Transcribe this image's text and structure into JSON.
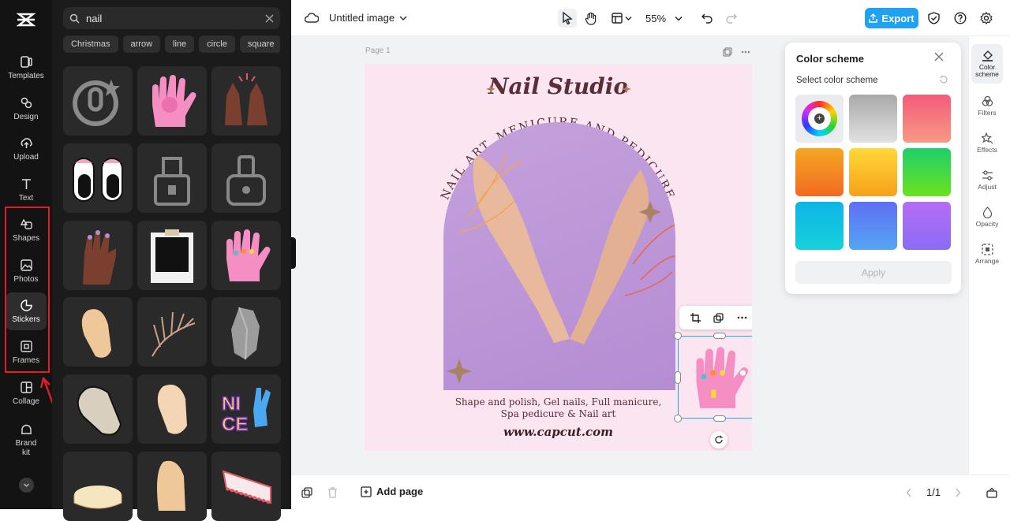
{
  "sidebar": {
    "items": [
      {
        "label": "Templates",
        "icon": "templates-icon"
      },
      {
        "label": "Design",
        "icon": "design-icon"
      },
      {
        "label": "Upload",
        "icon": "upload-icon"
      },
      {
        "label": "Text",
        "icon": "text-icon"
      },
      {
        "label": "Shapes",
        "icon": "shapes-icon"
      },
      {
        "label": "Photos",
        "icon": "photos-icon"
      },
      {
        "label": "Stickers",
        "icon": "stickers-icon"
      },
      {
        "label": "Frames",
        "icon": "frames-icon"
      },
      {
        "label": "Collage",
        "icon": "collage-icon"
      },
      {
        "label": "Brand kit",
        "icon": "brand-kit-icon"
      }
    ],
    "active": "Stickers"
  },
  "search": {
    "value": "nail"
  },
  "chips": [
    "Christmas",
    "arrow",
    "line",
    "circle",
    "square"
  ],
  "topbar": {
    "doc_title": "Untitled image",
    "zoom": "55%",
    "export_label": "Export"
  },
  "workspace": {
    "page_label": "Page 1"
  },
  "canvas": {
    "title": "Nail Studio",
    "arc_text": "NAIL ART, MENICURE AND PEDICURE",
    "desc_line1": "Shape and polish, Gel nails, Full manicure,",
    "desc_line2": "Spa pedicure & Nail art",
    "url": "www.capcut.com"
  },
  "color_scheme": {
    "title": "Color scheme",
    "subtitle": "Select color scheme",
    "apply_label": "Apply",
    "swatches": [
      "picker",
      "#c9c9c9",
      "#f06b80",
      "#f7941d",
      "#fdd835",
      "#22c55e",
      "#13b5e8",
      "#6f7ff7",
      "#a66cf6"
    ]
  },
  "right_rail": [
    {
      "label": "Color scheme",
      "icon": "color-scheme-icon"
    },
    {
      "label": "Filters",
      "icon": "filters-icon"
    },
    {
      "label": "Effects",
      "icon": "effects-icon"
    },
    {
      "label": "Adjust",
      "icon": "adjust-icon"
    },
    {
      "label": "Opacity",
      "icon": "opacity-icon"
    },
    {
      "label": "Arrange",
      "icon": "arrange-icon"
    }
  ],
  "bottom": {
    "add_page_label": "Add page",
    "page_count": "1/1"
  },
  "colors": {
    "accent": "#1ea2f1",
    "highlight": "#e51c23",
    "rail_bg": "#131313"
  }
}
